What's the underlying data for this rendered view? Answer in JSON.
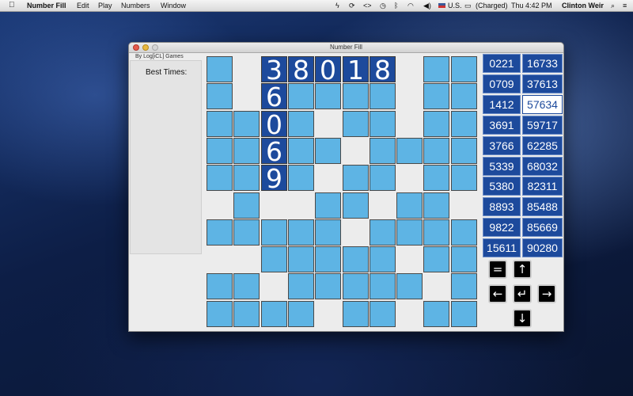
{
  "menubar": {
    "app_name": "Number Fill",
    "menus": [
      "Edit",
      "Play",
      "Numbers",
      "Window"
    ],
    "status": {
      "input_source": "U.S.",
      "battery": "(Charged)",
      "clock": "Thu 4:42 PM",
      "user": "Clinton Weir"
    }
  },
  "window": {
    "title": "Number Fill",
    "byline": "By Log[iCL] Games",
    "best_times_label": "Best Times:"
  },
  "board": {
    "rows": [
      [
        "B",
        "W",
        "F3",
        "F8",
        "F0",
        "F1",
        "F8",
        "W",
        "B",
        "B"
      ],
      [
        "B",
        "W",
        "F6",
        "B",
        "B",
        "B",
        "B",
        "W",
        "B",
        "B"
      ],
      [
        "B",
        "B",
        "F0",
        "B",
        "W",
        "B",
        "B",
        "W",
        "B",
        "B"
      ],
      [
        "B",
        "B",
        "F6",
        "B",
        "B",
        "W",
        "B",
        "B",
        "B",
        "B"
      ],
      [
        "B",
        "B",
        "F9",
        "B",
        "W",
        "B",
        "B",
        "W",
        "B",
        "B"
      ],
      [
        "W",
        "B",
        "W",
        "W",
        "B",
        "B",
        "W",
        "B",
        "B",
        "W"
      ],
      [
        "B",
        "B",
        "B",
        "B",
        "B",
        "W",
        "B",
        "B",
        "B",
        "B"
      ],
      [
        "W",
        "W",
        "B",
        "B",
        "B",
        "B",
        "B",
        "W",
        "B",
        "B"
      ],
      [
        "B",
        "B",
        "W",
        "B",
        "B",
        "B",
        "B",
        "B",
        "W",
        "B"
      ],
      [
        "B",
        "B",
        "B",
        "B",
        "W",
        "B",
        "B",
        "W",
        "B",
        "B"
      ]
    ]
  },
  "numbers": {
    "left": [
      "0221",
      "0709",
      "1412",
      "3691",
      "3766",
      "5339",
      "5380",
      "8893",
      "9822",
      "15611"
    ],
    "right": [
      "16733",
      "37613",
      "57634",
      "59717",
      "62285",
      "68032",
      "82311",
      "85488",
      "85669",
      "90280"
    ],
    "used_right": [
      2
    ]
  },
  "controls": {
    "swap": "=",
    "up": "↑",
    "left": "←",
    "enter": "↵",
    "right": "→",
    "down": "↓"
  }
}
